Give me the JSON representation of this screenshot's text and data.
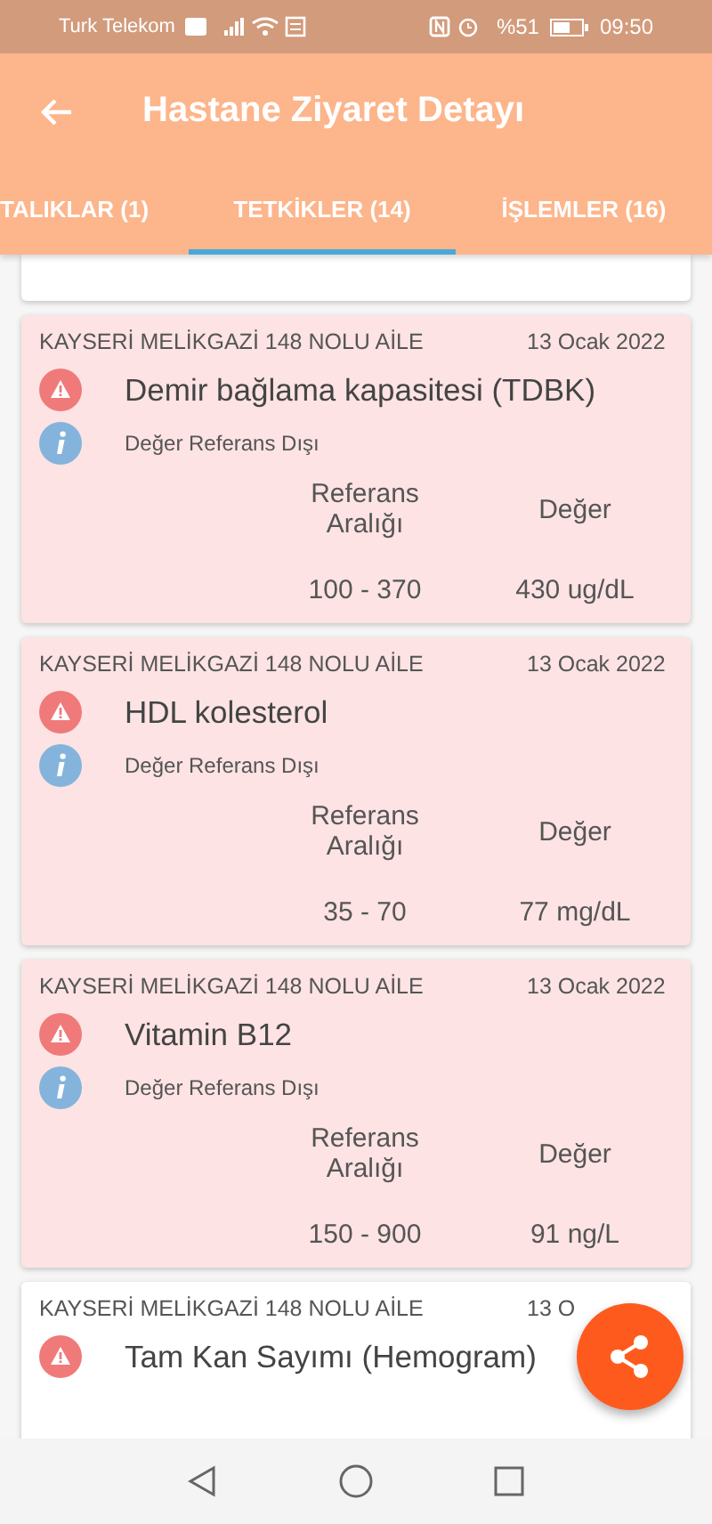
{
  "status_bar": {
    "carrier": "Turk Telekom",
    "battery_percent": "%51",
    "time": "09:50"
  },
  "app_bar": {
    "title": "Hastane Ziyaret Detayı"
  },
  "tabs": [
    {
      "label": "TALIKLAR (1)",
      "selected": false
    },
    {
      "label": "TETKİKLER (14)",
      "selected": true
    },
    {
      "label": "İŞLEMLER (16)",
      "selected": false
    }
  ],
  "cards": [
    {
      "kind": "partial",
      "highlighted": false
    },
    {
      "kind": "full",
      "highlighted": true,
      "facility": "KAYSERİ MELİKGAZİ 148 NOLU AİLE",
      "date": "13 Ocak 2022",
      "test": "Demir bağlama kapasitesi (TDBK)",
      "note": "Değer Referans Dışı",
      "reference_header": "Referans Aralığı",
      "value_header": "Değer",
      "reference": "100 - 370",
      "value": "430 ug/dL"
    },
    {
      "kind": "full",
      "highlighted": true,
      "facility": "KAYSERİ MELİKGAZİ 148 NOLU AİLE",
      "date": "13 Ocak 2022",
      "test": "HDL kolesterol",
      "note": "Değer Referans Dışı",
      "reference_header": "Referans Aralığı",
      "value_header": "Değer",
      "reference": "35 - 70",
      "value": "77 mg/dL"
    },
    {
      "kind": "full",
      "highlighted": true,
      "facility": "KAYSERİ MELİKGAZİ 148 NOLU AİLE",
      "date": "13 Ocak 2022",
      "test": "Vitamin B12",
      "note": "Değer Referans Dışı",
      "reference_header": "Referans Aralığı",
      "value_header": "Değer",
      "reference": "150 - 900",
      "value": "91 ng/L"
    },
    {
      "kind": "top",
      "highlighted": false,
      "facility": "KAYSERİ MELİKGAZİ 148 NOLU AİLE",
      "date": "13 O",
      "test": "Tam Kan Sayımı (Hemogram)"
    }
  ]
}
